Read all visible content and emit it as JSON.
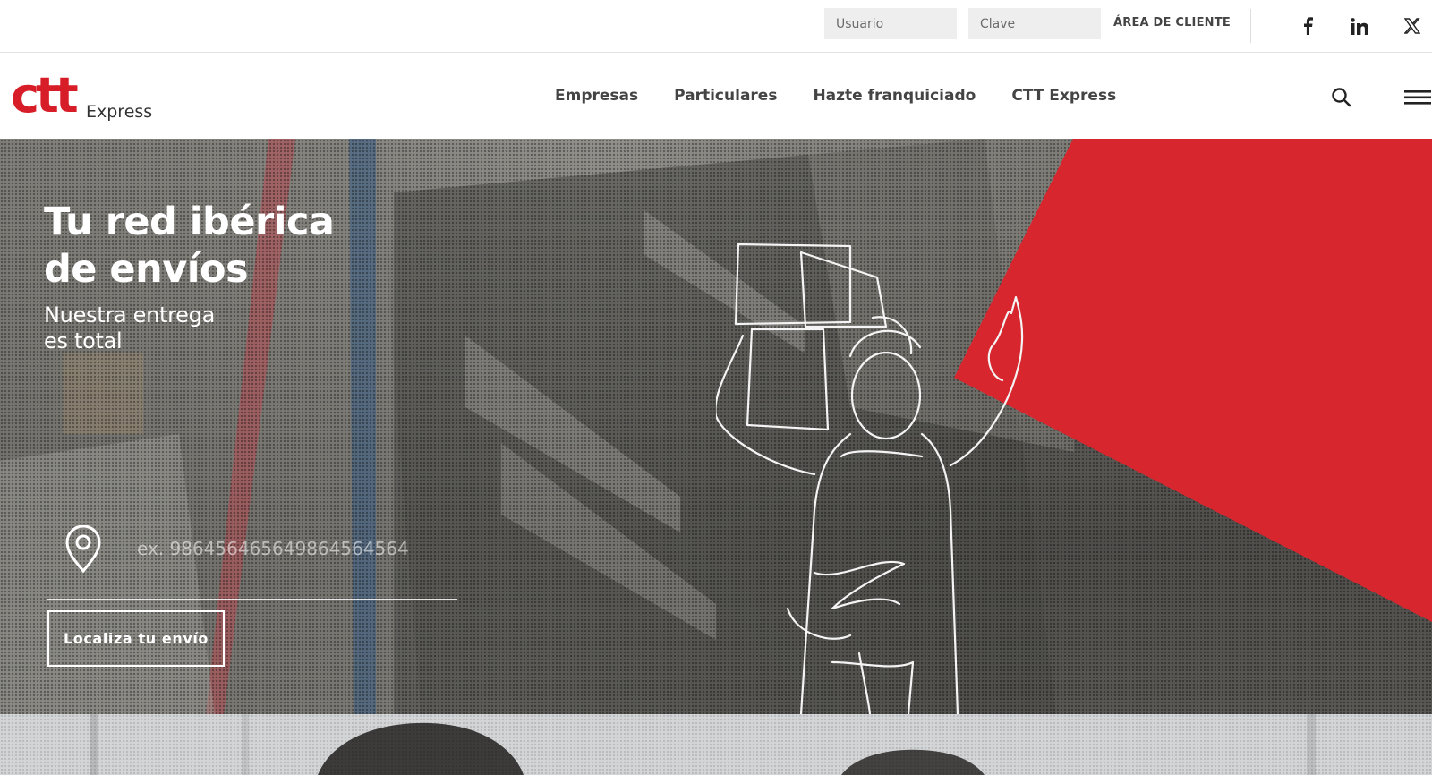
{
  "topbar": {
    "user_placeholder": "Usuario",
    "password_placeholder": "Clave",
    "client_area_label": "ÁREA DE CLIENTE",
    "social": [
      "facebook-icon",
      "linkedin-icon",
      "x-icon"
    ]
  },
  "brand": {
    "logo_main": "ctt",
    "logo_sub": "Express",
    "red": "#d71e28"
  },
  "nav": {
    "items": [
      "Empresas",
      "Particulares",
      "Hazte franquiciado",
      "CTT Express"
    ]
  },
  "hero": {
    "title": "Tu red ibérica\nde envíos",
    "subtitle": "Nuestra entrega\nes total",
    "tracking_placeholder": "ex. 986456465649864564564",
    "tracking_button": "Localiza tu envío",
    "accent": "#d7262e"
  }
}
